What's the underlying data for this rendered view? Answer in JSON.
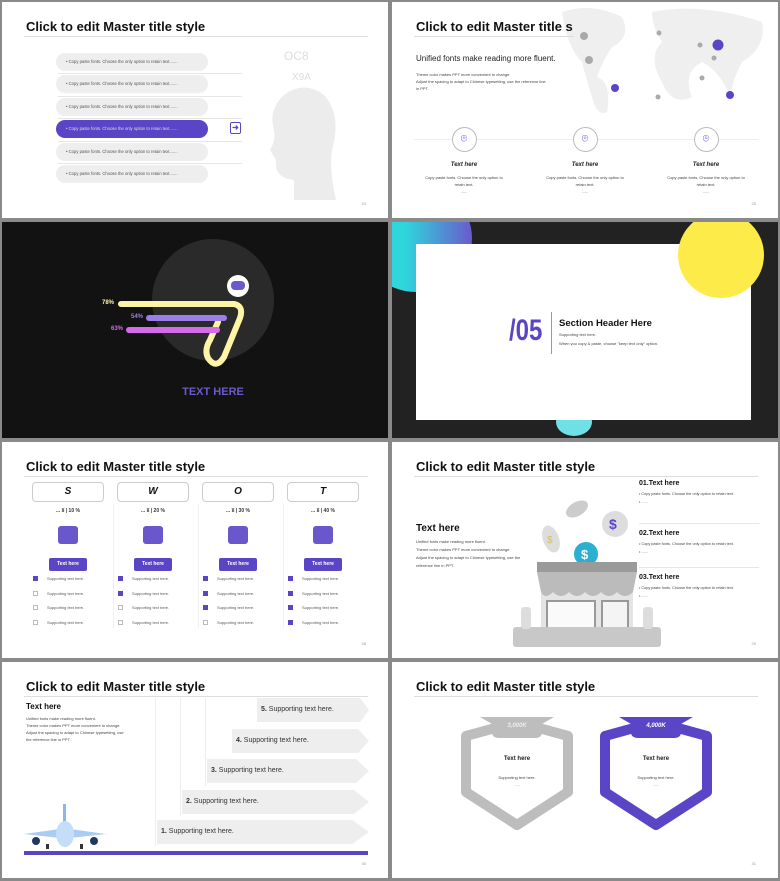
{
  "master_title": "Click to edit Master title style",
  "colors": {
    "accent": "#5b45c7",
    "dark_bg": "#121212",
    "yellow": "#fdeb4a",
    "teal": "#2fd6dc"
  },
  "slide1": {
    "items": [
      "Copy paste fonts. Choose the only option to retain text.......",
      "Copy paste fonts. Choose the only option to retain text.......",
      "Copy paste fonts. Choose the only option to retain text.......",
      "Copy paste fonts. Choose the only option to retain text.......",
      "Copy paste fonts. Choose the only option to retain text.......",
      "Copy paste fonts. Choose the only option to retain text......."
    ],
    "active_index": 3,
    "page": "24",
    "icon": "exit-arrow-icon"
  },
  "slide2": {
    "title": "Click to edit Master title s",
    "subtitle": "Unified fonts make reading more fluent.",
    "body": [
      "Theme color makes PPT more convenient to change.",
      "Adjust the spacing to adapt to Chinese typesetting, use the reference line",
      "in PPT."
    ],
    "cards": [
      {
        "title": "Text here",
        "desc1": "Copy paste fonts. Choose the only option to",
        "desc2": "retain text.",
        "dots": "......"
      },
      {
        "title": "Text here",
        "desc1": "Copy paste fonts. Choose the only option to",
        "desc2": "retain text.",
        "dots": "......"
      },
      {
        "title": "Text here",
        "desc1": "Copy paste fonts. Choose the only option to",
        "desc2": "retain text.",
        "dots": "......"
      }
    ],
    "page": "25",
    "icon": "location-pin-icon"
  },
  "slide3": {
    "bars": [
      {
        "label": "78%",
        "value": 78,
        "color": "#fdf5a6"
      },
      {
        "label": "54%",
        "value": 54,
        "color": "#9b7fe6"
      },
      {
        "label": "63%",
        "value": 63,
        "color": "#d56bea"
      }
    ],
    "caption": "TEXT HERE",
    "icon": "gamepad-icon"
  },
  "slide4": {
    "number": "/05",
    "header": "Section Header Here",
    "line1": "Supporting text here.",
    "line2": "When you copy & paste, choose \"keep text only\" option."
  },
  "slide5": {
    "columns": [
      {
        "letter": "S",
        "pct": "... ¥ | 10 %",
        "button": "Text here",
        "checks": [
          true,
          false,
          false,
          false
        ],
        "icon": "person-money-icon"
      },
      {
        "letter": "W",
        "pct": "... ¥ | 20 %",
        "button": "Text here",
        "checks": [
          true,
          true,
          false,
          false
        ],
        "icon": "growth-chart-icon"
      },
      {
        "letter": "O",
        "pct": "... ¥ | 30 %",
        "button": "Text here",
        "checks": [
          true,
          true,
          true,
          false
        ],
        "icon": "hand-card-icon"
      },
      {
        "letter": "T",
        "pct": "... ¥ | 40 %",
        "button": "Text here",
        "checks": [
          true,
          true,
          true,
          true
        ],
        "icon": "briefcase-icon"
      }
    ],
    "check_label": "Supporting text here.",
    "page": "28"
  },
  "slide6": {
    "left_title": "Text here",
    "left_body": [
      "Unified fonts make reading more fluent.",
      "Theme color makes PPT more convenient to change.",
      "Adjust the spacing to adapt to Chinese typesetting, use the",
      "reference line in PPT."
    ],
    "items": [
      {
        "title": "01.Text here",
        "bullet": "Copy paste fonts. Choose the only option to retain text.",
        "dots": "......"
      },
      {
        "title": "02.Text here",
        "bullet": "Copy paste fonts. Choose the only option to retain text.",
        "dots": "......"
      },
      {
        "title": "03.Text here",
        "bullet": "Copy paste fonts. Choose the only option to retain text.",
        "dots": "......"
      }
    ],
    "page": "29"
  },
  "slide7": {
    "left_title": "Text here",
    "left_body": [
      "Unified fonts make reading more fluent.",
      "Theme color makes PPT more convenient to change.",
      "Adjust the spacing to adapt to Chinese typesetting, use",
      "the reference line in PPT."
    ],
    "steps": [
      {
        "num": "1.",
        "text": "Supporting text here."
      },
      {
        "num": "2.",
        "text": "Supporting text here."
      },
      {
        "num": "3.",
        "text": "Supporting text here."
      },
      {
        "num": "4.",
        "text": "Supporting text here."
      },
      {
        "num": "5.",
        "text": "Supporting text here."
      }
    ],
    "page": "30"
  },
  "slide8": {
    "cards": [
      {
        "value": "3,000K",
        "title": "Text here",
        "desc": "Supporting text here.",
        "dots": "......",
        "color": "#bdbdbd"
      },
      {
        "value": "4,000K",
        "title": "Text here",
        "desc": "Supporting text here.",
        "dots": "......",
        "color": "#5b45c7"
      }
    ],
    "page": "31"
  }
}
